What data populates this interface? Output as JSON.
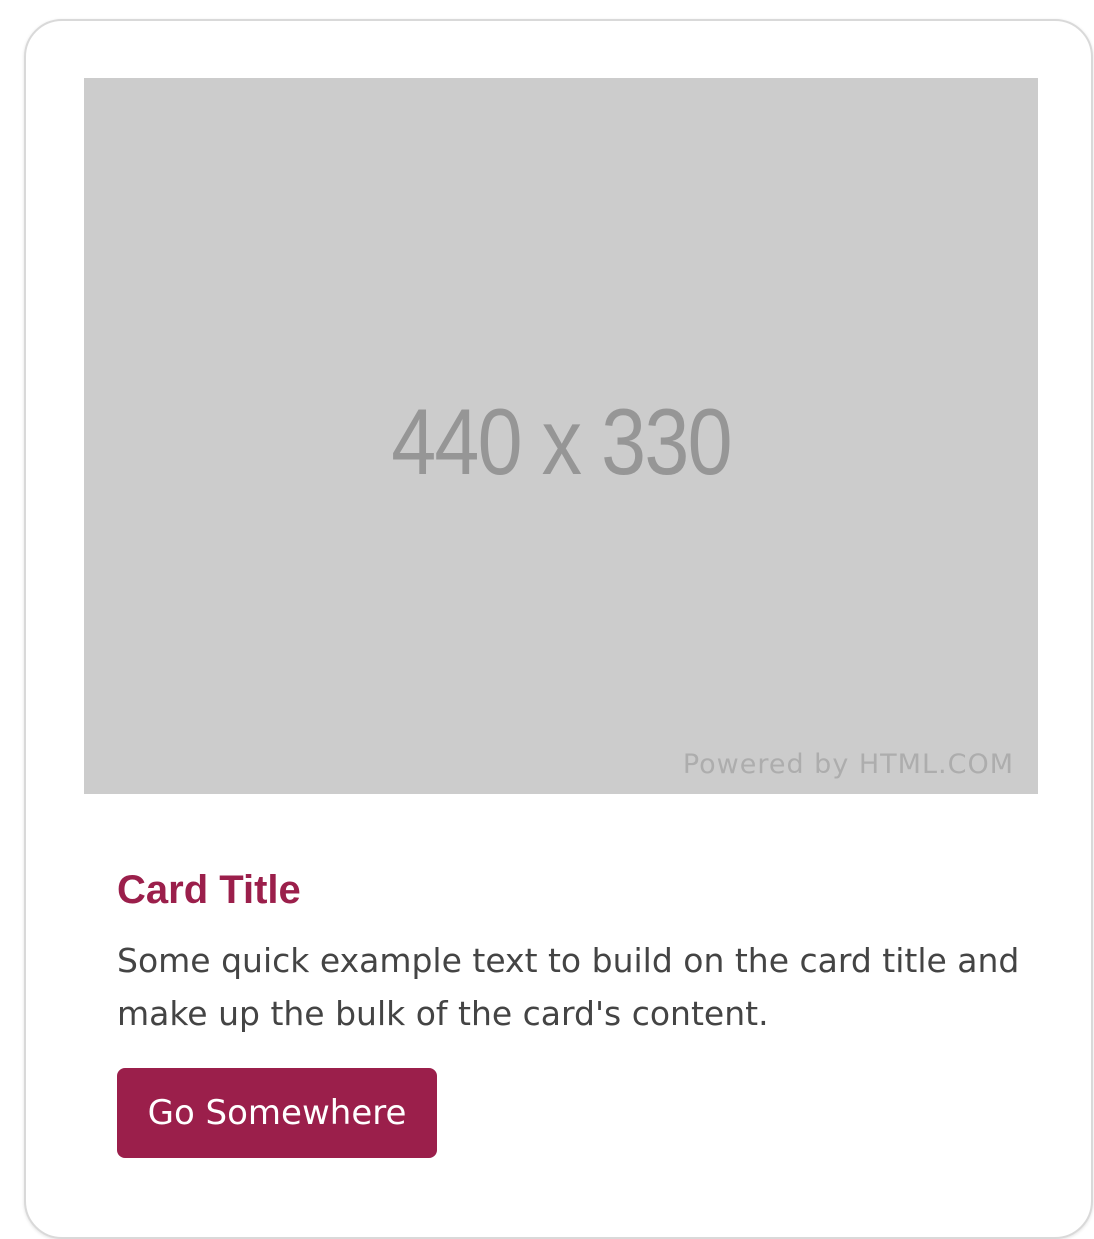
{
  "card": {
    "image": {
      "dimensions_text": "440 x 330",
      "credit_text": "Powered by HTML.COM",
      "background_color": "#cccccc"
    },
    "title": "Card Title",
    "text": "Some quick example text to build on the card title and make up the bulk of the card's content.",
    "button_label": "Go Somewhere",
    "accent_color": "#9b1f4b"
  }
}
